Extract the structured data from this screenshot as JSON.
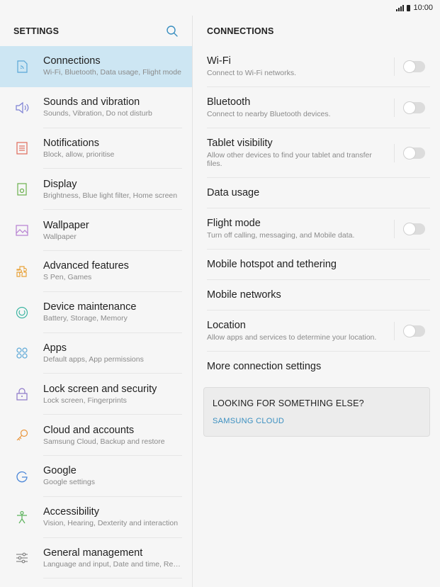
{
  "status": {
    "time": "10:00"
  },
  "left": {
    "header": "SETTINGS",
    "items": [
      {
        "title": "Connections",
        "sub": "Wi-Fi, Bluetooth, Data usage, Flight mode",
        "icon": "connections-icon"
      },
      {
        "title": "Sounds and vibration",
        "sub": "Sounds, Vibration, Do not disturb",
        "icon": "speaker-icon"
      },
      {
        "title": "Notifications",
        "sub": "Block, allow, prioritise",
        "icon": "notifications-icon"
      },
      {
        "title": "Display",
        "sub": "Brightness, Blue light filter, Home screen",
        "icon": "display-icon"
      },
      {
        "title": "Wallpaper",
        "sub": "Wallpaper",
        "icon": "wallpaper-icon"
      },
      {
        "title": "Advanced features",
        "sub": "S Pen, Games",
        "icon": "puzzle-icon"
      },
      {
        "title": "Device maintenance",
        "sub": "Battery, Storage, Memory",
        "icon": "maintenance-icon"
      },
      {
        "title": "Apps",
        "sub": "Default apps, App permissions",
        "icon": "apps-icon"
      },
      {
        "title": "Lock screen and security",
        "sub": "Lock screen, Fingerprints",
        "icon": "lock-icon"
      },
      {
        "title": "Cloud and accounts",
        "sub": "Samsung Cloud, Backup and restore",
        "icon": "key-icon"
      },
      {
        "title": "Google",
        "sub": "Google settings",
        "icon": "google-icon"
      },
      {
        "title": "Accessibility",
        "sub": "Vision, Hearing, Dexterity and interaction",
        "icon": "accessibility-icon"
      },
      {
        "title": "General management",
        "sub": "Language and input, Date and time, Res...",
        "icon": "sliders-icon"
      }
    ]
  },
  "right": {
    "header": "CONNECTIONS",
    "items": [
      {
        "title": "Wi-Fi",
        "sub": "Connect to Wi-Fi networks.",
        "toggle": true
      },
      {
        "title": "Bluetooth",
        "sub": "Connect to nearby Bluetooth devices.",
        "toggle": true
      },
      {
        "title": "Tablet visibility",
        "sub": "Allow other devices to find your tablet and transfer files.",
        "toggle": true
      },
      {
        "title": "Data usage",
        "sub": "",
        "toggle": false
      },
      {
        "title": "Flight mode",
        "sub": "Turn off calling, messaging, and Mobile data.",
        "toggle": true
      },
      {
        "title": "Mobile hotspot and tethering",
        "sub": "",
        "toggle": false
      },
      {
        "title": "Mobile networks",
        "sub": "",
        "toggle": false
      },
      {
        "title": "Location",
        "sub": "Allow apps and services to determine your location.",
        "toggle": true
      },
      {
        "title": "More connection settings",
        "sub": "",
        "toggle": false
      }
    ],
    "card": {
      "title": "LOOKING FOR SOMETHING ELSE?",
      "link": "SAMSUNG CLOUD"
    }
  },
  "colors": {
    "accent": "#3a8fc0",
    "selected": "#cde6f3"
  }
}
